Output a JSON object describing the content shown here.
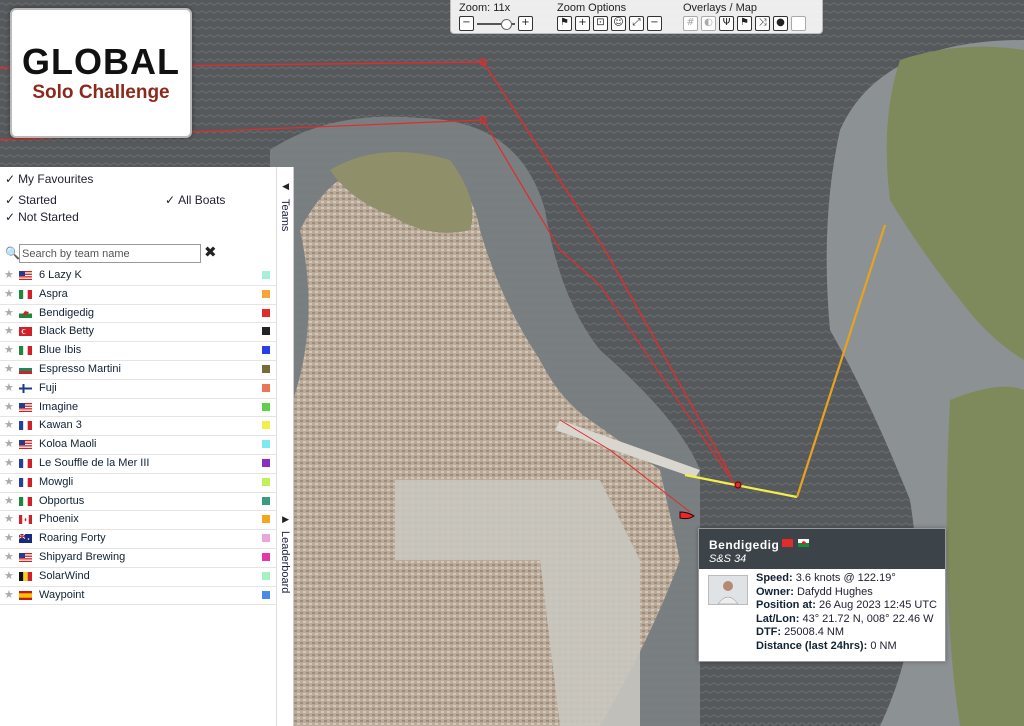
{
  "logo": {
    "line1": "GLOBAL",
    "line2": "Solo Challenge"
  },
  "toolbar": {
    "zoom_label": "Zoom: 11x",
    "zoom_options_label": "Zoom Options",
    "overlays_label": "Overlays / Map"
  },
  "panel": {
    "filters": {
      "favourites": "My Favourites",
      "started": "Started",
      "all_boats": "All Boats",
      "not_started": "Not Started"
    },
    "search_placeholder": "Search by team name",
    "teams_tab": "Teams",
    "leaderboard_tab": "Leaderboard",
    "teams": [
      {
        "name": "6 Lazy K",
        "flag": "us",
        "color": "#a7f0d8"
      },
      {
        "name": "Aspra",
        "flag": "it",
        "color": "#f5a53a"
      },
      {
        "name": "Bendigedig",
        "flag": "wales",
        "color": "#e02c2c"
      },
      {
        "name": "Black Betty",
        "flag": "tr",
        "color": "#222222"
      },
      {
        "name": "Blue Ibis",
        "flag": "it",
        "color": "#2a3ee6"
      },
      {
        "name": "Espresso Martini",
        "flag": "bg",
        "color": "#7a6a3a"
      },
      {
        "name": "Fuji",
        "flag": "fi",
        "color": "#e8775a"
      },
      {
        "name": "Imagine",
        "flag": "us",
        "color": "#62d04a"
      },
      {
        "name": "Kawan 3",
        "flag": "fr",
        "color": "#f2ef4a"
      },
      {
        "name": "Koloa Maoli",
        "flag": "us",
        "color": "#7fe8f0"
      },
      {
        "name": "Le Souffle de la Mer III",
        "flag": "fr",
        "color": "#8a2fbf"
      },
      {
        "name": "Mowgli",
        "flag": "fr",
        "color": "#c0f05a"
      },
      {
        "name": "Obportus",
        "flag": "it",
        "color": "#3a9a82"
      },
      {
        "name": "Phoenix",
        "flag": "ca",
        "color": "#f4a71e"
      },
      {
        "name": "Roaring Forty",
        "flag": "au",
        "color": "#e8a7d8"
      },
      {
        "name": "Shipyard Brewing",
        "flag": "us",
        "color": "#e03aa8"
      },
      {
        "name": "SolarWind",
        "flag": "be",
        "color": "#a7f0c0"
      },
      {
        "name": "Waypoint",
        "flag": "es",
        "color": "#4a8ae8"
      }
    ]
  },
  "popup": {
    "name": "Bendigedig",
    "boat_class": "S&S 34",
    "speed_label": "Speed:",
    "speed": "3.6 knots @ 122.19°",
    "owner_label": "Owner:",
    "owner": "Dafydd Hughes",
    "position_label": "Position at:",
    "position": "26 Aug 2023 12:45 UTC",
    "latlon_label": "Lat/Lon:",
    "latlon": "43° 21.72 N, 008° 22.46 W",
    "dtf_label": "DTF:",
    "dtf": "25008.4 NM",
    "distance_label": "Distance (last 24hrs):",
    "distance": "0 NM"
  },
  "colors": {
    "track_red": "#e02c2c",
    "track_yellow": "#f2ef4a",
    "track_orange": "#e8a31e",
    "popup_header": "#3c4449"
  }
}
